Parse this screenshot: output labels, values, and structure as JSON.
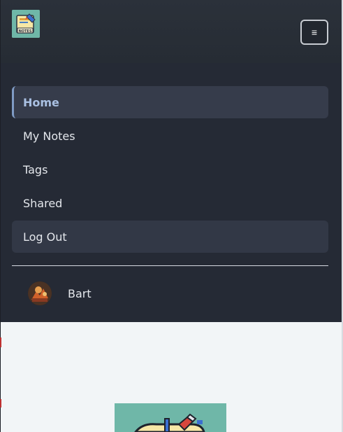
{
  "app": {
    "name": "Notes",
    "logo_text": "NOTES",
    "brand_color": "#6fb7a8"
  },
  "header": {
    "menu_toggle": {
      "icon": "hamburger-icon",
      "glyph": "≡",
      "expanded": true
    }
  },
  "nav": {
    "items": [
      {
        "label": "Home",
        "active": true
      },
      {
        "label": "My Notes",
        "active": false
      },
      {
        "label": "Tags",
        "active": false
      },
      {
        "label": "Shared",
        "active": false
      },
      {
        "label": "Log Out",
        "active": false
      }
    ]
  },
  "user": {
    "name": "Bart",
    "avatar": "user-avatar"
  },
  "colors": {
    "panel_bg": "#252a35",
    "active_bg": "#363c4b",
    "active_accent": "#7f9bc4",
    "page_bg": "#f2f5f7"
  }
}
